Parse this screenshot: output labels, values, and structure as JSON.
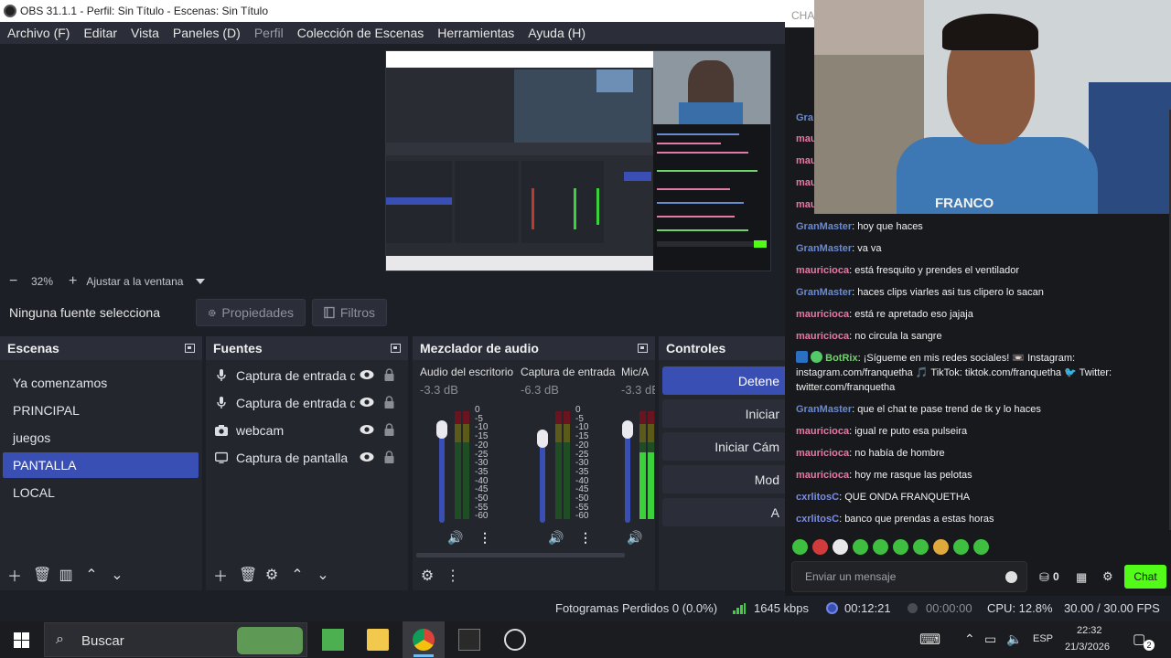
{
  "obs": {
    "title": "OBS 31.1.1 - Perfil: Sin Título - Escenas: Sin Título",
    "menu": [
      "Archivo (F)",
      "Editar",
      "Vista",
      "Paneles (D)",
      "Perfil",
      "Colección de Escenas",
      "Herramientas",
      "Ayuda (H)"
    ],
    "zoom": {
      "minus": "−",
      "value": "32%",
      "plus": "+",
      "fit": "Ajustar a la ventana"
    },
    "no_source": "Ninguna fuente selecciona",
    "properties_label": "Propiedades",
    "filters_label": "Filtros",
    "docks": {
      "scenes_title": "Escenas",
      "sources_title": "Fuentes",
      "mixer_title": "Mezclador de audio",
      "controls_title": "Controles"
    },
    "scenes": [
      "Ya comenzamos",
      "PRINCIPAL",
      "juegos",
      "PANTALLA",
      "LOCAL"
    ],
    "selected_scene_index": 3,
    "sources": [
      {
        "name": "Captura de entrada de audio",
        "icon": "microphone-icon"
      },
      {
        "name": "Captura de entrada de audio",
        "icon": "microphone-icon"
      },
      {
        "name": "webcam",
        "icon": "camera-icon"
      },
      {
        "name": "Captura de pantalla",
        "icon": "monitor-icon"
      }
    ],
    "mixer": [
      {
        "name": "Audio del escritorio",
        "db": "-3.3 dB",
        "fader": 0.84,
        "level": 0.0
      },
      {
        "name": "Captura de entrada",
        "db": "-6.3 dB",
        "fader": 0.79,
        "level": 0.0
      },
      {
        "name": "Mic/A",
        "db": "-3.3 dB",
        "fader": 0.84,
        "level": 0.62
      }
    ],
    "meter_scale": [
      "0",
      "-5",
      "-10",
      "-15",
      "-20",
      "-25",
      "-30",
      "-35",
      "-40",
      "-45",
      "-50",
      "-55",
      "-60"
    ],
    "controls": [
      "Detene",
      "Iniciar",
      "Iniciar Cám",
      "Mod",
      "A"
    ],
    "status": {
      "dropped": "Fotogramas Perdidos 0 (0.0%)",
      "bitrate": "1645 kbps",
      "live_time": "00:12:21",
      "rec_time": "00:00:00",
      "cpu": "CPU: 12.8%",
      "fps": "30.00 / 30.00 FPS"
    }
  },
  "chat": {
    "header_partial": "CHA",
    "partial_users": [
      "Gra",
      "mau",
      "mau",
      "mau",
      "mau"
    ],
    "messages": [
      {
        "user": "GranMaster",
        "text": ": hoy que haces",
        "kind": "gran"
      },
      {
        "user": "GranMaster",
        "text": ": va va",
        "kind": "gran"
      },
      {
        "user": "mauricioca",
        "text": ": está fresquito y prendes el ventilador",
        "kind": "mau"
      },
      {
        "user": "GranMaster",
        "text": ": haces clips viarles asi tus clipero lo sacan",
        "kind": "gran"
      },
      {
        "user": "mauricioca",
        "text": ": está re apretado eso jajaja",
        "kind": "mau"
      },
      {
        "user": "mauricioca",
        "text": ": no circula la sangre",
        "kind": "mau"
      },
      {
        "user": "GranMaster",
        "text": ": que el chat te pase trend de tk y lo haces",
        "kind": "gran"
      },
      {
        "user": "mauricioca",
        "text": ": igual re puto esa pulseira",
        "kind": "mau"
      },
      {
        "user": "mauricioca",
        "text": ": no había de hombre",
        "kind": "mau"
      },
      {
        "user": "mauricioca",
        "text": ": hoy me rasque las pelotas",
        "kind": "mau"
      },
      {
        "user": "cxrlitosC",
        "text": ": QUE ONDA FRANQUETHA",
        "kind": "cxr"
      },
      {
        "user": "cxrlitosC",
        "text": ": banco que prendas a estas horas",
        "kind": "cxr"
      }
    ],
    "bot_message": {
      "user": "BotRix",
      "line1": ": ¡Sígueme en mis redes sociales! 📼 Instagram:",
      "line2": "instagram.com/franquetha 🎵 TikTok: tiktok.com/franquetha 🐦 Twitter:",
      "line3": "twitter.com/franquetha"
    },
    "input_placeholder": "Enviar un mensaje",
    "points": "0",
    "send_label": "Chat",
    "webcam_shirt_text": "FRANCO"
  },
  "taskbar": {
    "search_placeholder": "Buscar",
    "lang": "ESP",
    "time": "22:32",
    "date": "21/3/2026",
    "notif_count": "2"
  },
  "colors": {
    "obs_bg": "#1d1f26",
    "obs_panel": "#2b2e38",
    "accent_blue": "#3a4fb4",
    "chat_bg": "#18191d",
    "kick_green": "#53fc18"
  }
}
